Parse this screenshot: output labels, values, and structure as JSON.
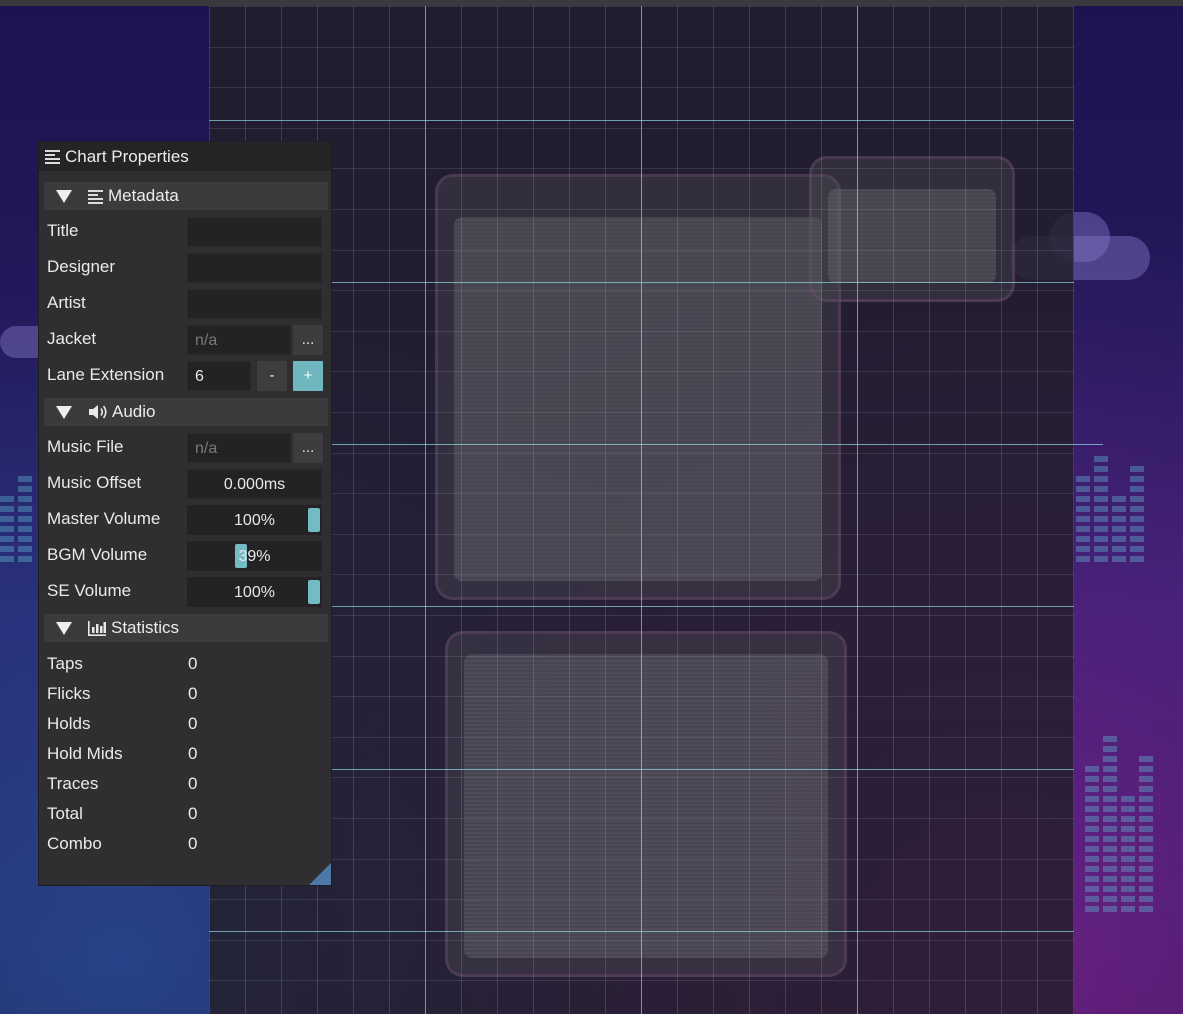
{
  "panel": {
    "title": "Chart Properties",
    "metadata": {
      "header": "Metadata",
      "title_label": "Title",
      "title_value": "",
      "designer_label": "Designer",
      "designer_value": "",
      "artist_label": "Artist",
      "artist_value": "",
      "jacket_label": "Jacket",
      "jacket_placeholder": "n/a",
      "browse_label": "...",
      "lane_extension_label": "Lane Extension",
      "lane_extension_value": "6",
      "decrement_label": "-",
      "increment_label": "+"
    },
    "audio": {
      "header": "Audio",
      "music_file_label": "Music File",
      "music_file_placeholder": "n/a",
      "browse_label": "...",
      "music_offset_label": "Music Offset",
      "music_offset_value": "0.000ms",
      "master_volume_label": "Master Volume",
      "master_volume_value": "100%",
      "master_volume_level": 1.0,
      "bgm_volume_label": "BGM Volume",
      "bgm_volume_value": "39%",
      "bgm_volume_level": 0.39,
      "se_volume_label": "SE Volume",
      "se_volume_value": "100%",
      "se_volume_level": 1.0
    },
    "statistics": {
      "header": "Statistics",
      "items": [
        {
          "label": "Taps",
          "value": "0"
        },
        {
          "label": "Flicks",
          "value": "0"
        },
        {
          "label": "Holds",
          "value": "0"
        },
        {
          "label": "Hold Mids",
          "value": "0"
        },
        {
          "label": "Traces",
          "value": "0"
        },
        {
          "label": "Total",
          "value": "0"
        },
        {
          "label": "Combo",
          "value": "0"
        }
      ]
    },
    "icons": {
      "title": "list-icon",
      "metadata": "list-icon",
      "audio": "speaker-icon",
      "statistics": "bar-chart-icon",
      "collapse": "triangle-down-icon"
    }
  },
  "colors": {
    "accent": "#6fb6bf",
    "panel_bg": "#2f2f31",
    "measure_line": "#8cdce6"
  }
}
